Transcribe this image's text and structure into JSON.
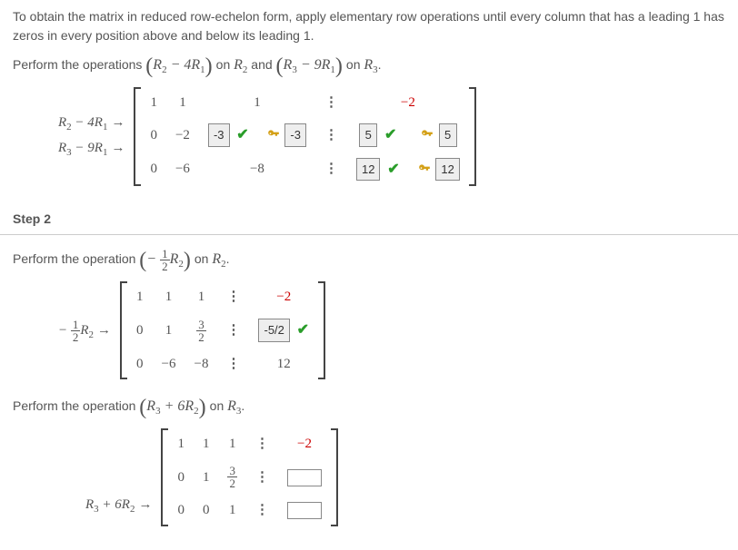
{
  "intro": "To obtain the matrix in reduced row-echelon form, apply elementary row operations until every column that has a leading 1 has zeros in every position above and below its leading 1.",
  "step1": {
    "perform_pre": "Perform the operations ",
    "op1_expr": "R₂ − 4R₁",
    "mid1": " on ",
    "on1": "R₂",
    "and": " and ",
    "op2_expr": "R₃ − 9R₁",
    "mid2": " on ",
    "on2": "R₃",
    "tail": ".",
    "rowop1": {
      "lhs": "R₂ − 4R₁"
    },
    "rowop2": {
      "lhs": "R₃ − 9R₁"
    },
    "matrix": {
      "r1": {
        "c1": "1",
        "c2": "1",
        "c3": "1",
        "aug": "−2"
      },
      "r2": {
        "c1": "0",
        "c2": "−2",
        "ans1": "-3",
        "ans2": "-3",
        "ans3": "5",
        "key": "5"
      },
      "r3": {
        "c1": "0",
        "c2": "−6",
        "c3": "−8",
        "ans1": "12",
        "key": "12"
      }
    }
  },
  "step2_header": "Step 2",
  "step2a": {
    "perform_pre": "Perform the operation ",
    "op_frac_num": "1",
    "op_frac_den": "2",
    "op_r": "R₂",
    "mid": " on ",
    "on": "R₂",
    "tail": ".",
    "rowop": {
      "num": "1",
      "den": "2",
      "r": "R₂"
    },
    "matrix": {
      "r1": {
        "c1": "1",
        "c2": "1",
        "c3": "1",
        "aug": "−2"
      },
      "r2": {
        "c1": "0",
        "c2": "1",
        "frac_num": "3",
        "frac_den": "2",
        "ans": "-5/2"
      },
      "r3": {
        "c1": "0",
        "c2": "−6",
        "c3": "−8",
        "aug": "12"
      }
    }
  },
  "step2b": {
    "perform_pre": "Perform the operation ",
    "op_expr": "R₃ + 6R₂",
    "mid": " on ",
    "on": "R₃",
    "tail": ".",
    "rowop": {
      "lhs": "R₃ + 6R₂"
    },
    "matrix": {
      "r1": {
        "c1": "1",
        "c2": "1",
        "c3": "1",
        "aug": "−2"
      },
      "r2": {
        "c1": "0",
        "c2": "1",
        "frac_num": "3",
        "frac_den": "2"
      },
      "r3": {
        "c1": "0",
        "c2": "0",
        "c3": "1"
      }
    }
  }
}
